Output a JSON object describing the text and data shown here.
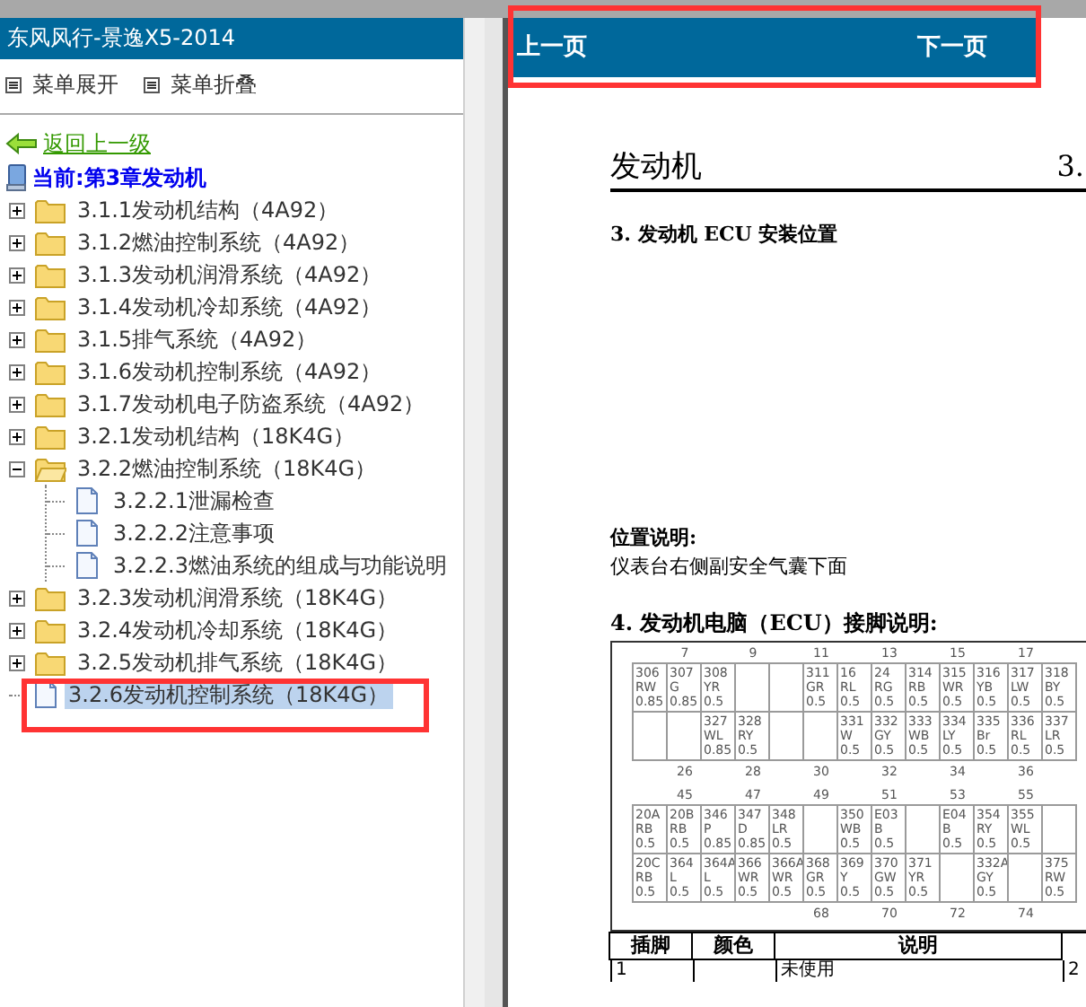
{
  "sidebar": {
    "title": "东风风行-景逸X5-2014",
    "menu_buttons": [
      "菜单展开",
      "菜单折叠"
    ],
    "back_link": "返回上一级",
    "current": "当前:第3章发动机",
    "tree": [
      {
        "label": "3.1.1发动机结构（4A92）",
        "kind": "folder",
        "expanded": false,
        "selected": false
      },
      {
        "label": "3.1.2燃油控制系统（4A92）",
        "kind": "folder",
        "expanded": false,
        "selected": false
      },
      {
        "label": "3.1.3发动机润滑系统（4A92）",
        "kind": "folder",
        "expanded": false,
        "selected": false
      },
      {
        "label": "3.1.4发动机冷却系统（4A92）",
        "kind": "folder",
        "expanded": false,
        "selected": false
      },
      {
        "label": "3.1.5排气系统（4A92）",
        "kind": "folder",
        "expanded": false,
        "selected": false
      },
      {
        "label": "3.1.6发动机控制系统（4A92）",
        "kind": "folder",
        "expanded": false,
        "selected": false
      },
      {
        "label": "3.1.7发动机电子防盗系统（4A92）",
        "kind": "folder",
        "expanded": false,
        "selected": false
      },
      {
        "label": "3.2.1发动机结构（18K4G）",
        "kind": "folder",
        "expanded": false,
        "selected": false
      },
      {
        "label": "3.2.2燃油控制系统（18K4G）",
        "kind": "folder",
        "expanded": true,
        "selected": false,
        "children": [
          {
            "label": "3.2.2.1泄漏检查",
            "kind": "page",
            "selected": false
          },
          {
            "label": "3.2.2.2注意事项",
            "kind": "page",
            "selected": false
          },
          {
            "label": "3.2.2.3燃油系统的组成与功能说明",
            "kind": "page",
            "selected": false
          }
        ]
      },
      {
        "label": "3.2.3发动机润滑系统（18K4G）",
        "kind": "folder",
        "expanded": false,
        "selected": false
      },
      {
        "label": "3.2.4发动机冷却系统（18K4G）",
        "kind": "folder",
        "expanded": false,
        "selected": false
      },
      {
        "label": "3.2.5发动机排气系统（18K4G）",
        "kind": "folder",
        "expanded": false,
        "selected": false
      },
      {
        "label": "3.2.6发动机控制系统（18K4G）",
        "kind": "page",
        "selected": true
      }
    ]
  },
  "nav": {
    "prev": "上一页",
    "next": "下一页"
  },
  "document": {
    "chapter_title": "发动机",
    "chapter_number": "3.",
    "section_heading": "3. 发动机 ECU 安装位置",
    "location_label": "位置说明:",
    "location_text": "仪表台右侧副安全气囊下面",
    "pinout_heading": "4. 发动机电脑（ECU）接脚说明:",
    "pinout": [
      {
        "columns": [
          {
            "cells": [
              [
                "306",
                "RW",
                "0.85"
              ],
              null
            ]
          },
          {
            "above": "7",
            "below": "26",
            "cells": [
              [
                "307",
                "G",
                "0.85"
              ],
              null
            ]
          },
          {
            "cells": [
              [
                "308",
                "YR",
                "0.5"
              ],
              [
                "327",
                "WL",
                "0.85"
              ]
            ]
          },
          {
            "above": "9",
            "below": "28",
            "cells": [
              null,
              [
                "328",
                "RY",
                "0.5"
              ]
            ]
          },
          {
            "cells": [
              null,
              null
            ]
          },
          {
            "above": "11",
            "below": "30",
            "cells": [
              [
                "311",
                "GR",
                "0.5"
              ],
              null
            ]
          },
          {
            "cells": [
              [
                "16",
                "RL",
                "0.5"
              ],
              [
                "331",
                "W",
                "0.5"
              ]
            ]
          },
          {
            "above": "13",
            "below": "32",
            "cells": [
              [
                "24",
                "RG",
                "0.5"
              ],
              [
                "332",
                "GY",
                "0.5"
              ]
            ]
          },
          {
            "cells": [
              [
                "314",
                "RB",
                "0.5"
              ],
              [
                "333",
                "WB",
                "0.5"
              ]
            ]
          },
          {
            "above": "15",
            "below": "34",
            "cells": [
              [
                "315",
                "WR",
                "0.5"
              ],
              [
                "334",
                "LY",
                "0.5"
              ]
            ]
          },
          {
            "cells": [
              [
                "316",
                "YB",
                "0.5"
              ],
              [
                "335",
                "Br",
                "0.5"
              ]
            ]
          },
          {
            "above": "17",
            "below": "36",
            "cells": [
              [
                "317",
                "LW",
                "0.5"
              ],
              [
                "336",
                "RL",
                "0.5"
              ]
            ]
          },
          {
            "cells": [
              [
                "318",
                "BY",
                "0.5"
              ],
              [
                "337",
                "LR",
                "0.5"
              ]
            ]
          }
        ]
      },
      {
        "columns": [
          {
            "cells": [
              [
                "20A",
                "RB",
                "0.5"
              ],
              [
                "20C",
                "RB",
                "0.5"
              ]
            ]
          },
          {
            "above": "45",
            "cells": [
              [
                "20B",
                "RB",
                "0.5"
              ],
              [
                "364",
                "L",
                "0.5"
              ]
            ]
          },
          {
            "cells": [
              [
                "346",
                "P",
                "0.85"
              ],
              [
                "364A",
                "L",
                "0.5"
              ]
            ]
          },
          {
            "above": "47",
            "cells": [
              [
                "347",
                "D",
                "0.85"
              ],
              [
                "366",
                "WR",
                "0.5"
              ]
            ]
          },
          {
            "cells": [
              [
                "348",
                "LR",
                "0.5"
              ],
              [
                "366A",
                "WR",
                "0.5"
              ]
            ]
          },
          {
            "above": "49",
            "below": "68",
            "cells": [
              null,
              [
                "368",
                "GR",
                "0.5"
              ]
            ]
          },
          {
            "cells": [
              [
                "350",
                "WB",
                "0.5"
              ],
              [
                "369",
                "Y",
                "0.5"
              ]
            ]
          },
          {
            "above": "51",
            "below": "70",
            "cells": [
              [
                "E03",
                "B",
                "0.5"
              ],
              [
                "370",
                "GW",
                "0.5"
              ]
            ]
          },
          {
            "cells": [
              null,
              [
                "371",
                "YR",
                "0.5"
              ]
            ]
          },
          {
            "above": "53",
            "below": "72",
            "cells": [
              [
                "E04",
                "B",
                "0.5"
              ],
              null
            ]
          },
          {
            "cells": [
              [
                "354",
                "RY",
                "0.5"
              ],
              [
                "332A",
                "GY",
                "0.5"
              ]
            ]
          },
          {
            "above": "55",
            "below": "74",
            "cells": [
              [
                "355",
                "WL",
                "0.5"
              ],
              null
            ]
          },
          {
            "cells": [
              null,
              [
                "375",
                "RW",
                "0.5"
              ]
            ]
          }
        ]
      }
    ],
    "table": {
      "columns": [
        "插脚",
        "颜色",
        "说明"
      ],
      "rows": [
        [
          "1",
          "",
          "未使用",
          "2"
        ]
      ]
    }
  }
}
